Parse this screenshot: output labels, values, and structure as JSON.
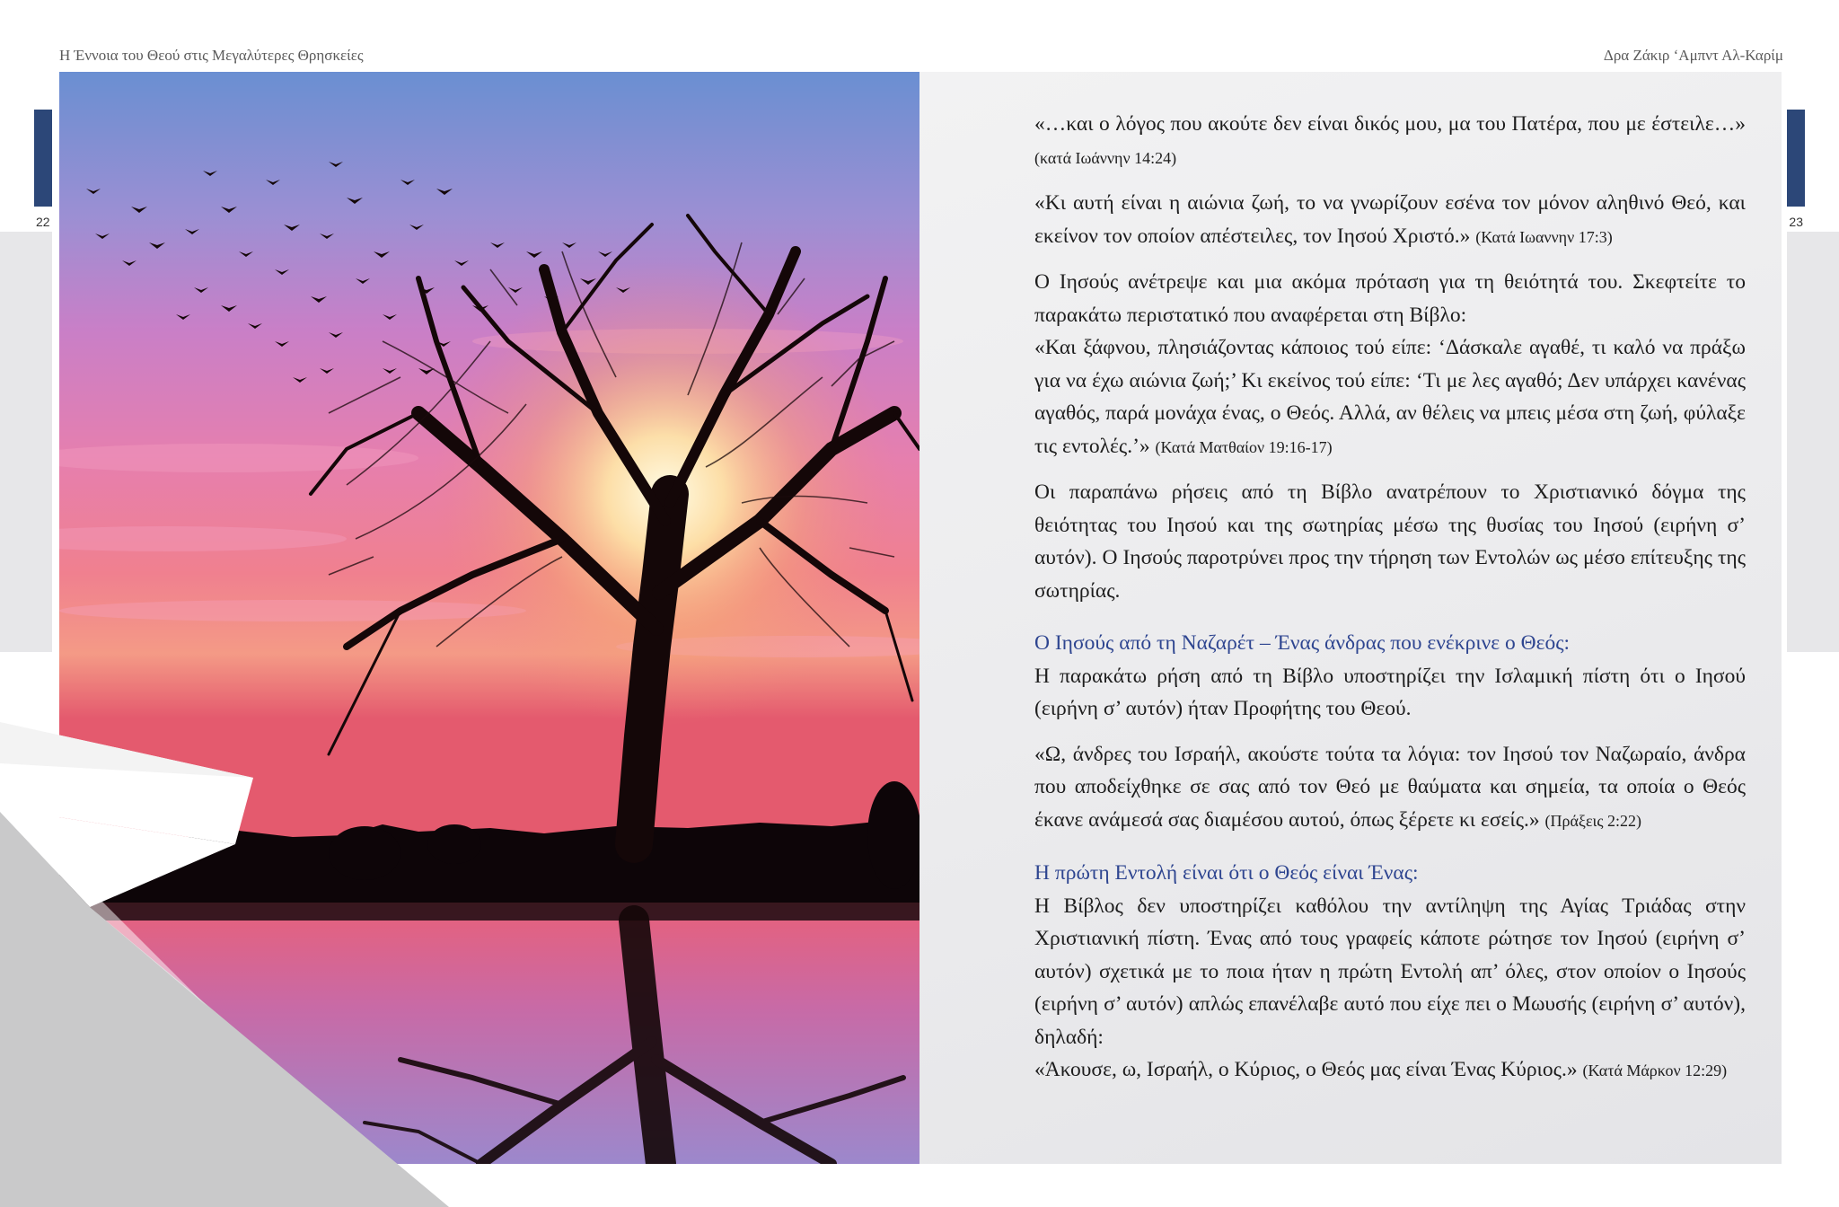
{
  "header": {
    "left_title": "Η Έννοια του Θεού στις Μεγαλύτερες Θρησκείες",
    "right_author": "Δρα Ζάκιρ ‘Αμπντ Αλ-Καρίμ"
  },
  "pages": {
    "left_number": "22",
    "right_number": "23"
  },
  "photo": {
    "icon": "tree-sunset-photo"
  },
  "text": {
    "p1_text": "«…και ο λόγος που ακούτε δεν είναι δικός μου, μα του Πατέρα, που με έστειλε…»",
    "p1_ref": "(κατά Ιωάννην 14:24)",
    "p2_text": "«Κι αυτή είναι η αιώνια ζωή, το να γνωρίζουν εσένα τον μόνον αληθινό Θεό, και εκείνον τον οποίον απέστειλες, τον Ιησού Χριστό.»",
    "p2_ref": "(Κατά Ιωαννην 17:3)",
    "p3_line1": "Ο Ιησούς ανέτρεψε και μια ακόμα πρόταση για τη θειότητά του. Σκεφτείτε το παρακάτω περιστατικό που αναφέρεται στη Βίβλο:",
    "p3_quote": "«Και ξάφνου, πλησιάζοντας κάποιος τού είπε: ‘Δάσκαλε αγαθέ, τι καλό να πράξω για να έχω αιώνια ζωή;’ Κι εκείνος τού είπε: ‘Τι με λες αγαθό; Δεν υπάρχει κανένας αγαθός, παρά μονάχα ένας, ο Θεός. Αλλά, αν θέλεις να μπεις μέσα στη ζωή, φύλαξε τις εντολές.’»",
    "p3_ref": "(Κατά Ματθαίον 19:16-17)",
    "p4_text": "Οι παραπάνω ρήσεις από τη Βίβλο ανατρέπουν το Χριστιανικό δόγμα της θειότητας του Ιησού και της σωτηρίας μέσω της θυσίας του Ιησού (ειρήνη σ’ αυτόν). Ο Ιησούς παροτρύνει προς την τήρηση των Εντολών ως μέσο επίτευξης της σωτηρίας.",
    "heading1": "Ο Ιησούς από τη Ναζαρέτ – Ένας άνδρας που ενέκρινε ο Θεός:",
    "p5_text": "Η παρακάτω ρήση από τη Βίβλο υποστηρίζει την Ισλαμική πίστη ότι ο Ιησού (ειρήνη σ’ αυτόν) ήταν Προφήτης του Θεού.",
    "p6_text": "«Ω, άνδρες του Ισραήλ, ακούστε τούτα τα λόγια: τον Ιησού τον Ναζωραίο, άνδρα που αποδείχθηκε σε σας από τον Θεό με θαύματα και σημεία, τα οποία ο Θεός έκανε ανάμεσά σας διαμέσου αυτού, όπως ξέρετε κι εσείς.»",
    "p6_ref": "(Πράξεις 2:22)",
    "heading2": "Η πρώτη Εντολή είναι ότι ο Θεός είναι Ένας:",
    "p7_text": "Η Βίβλος δεν υποστηρίζει καθόλου την αντίληψη της Αγίας Τριάδας στην Χριστιανική πίστη. Ένας από τους γραφείς κάποτε ρώτησε τον Ιησού (ειρήνη σ’ αυτόν) σχετικά με το ποια ήταν η πρώτη Εντολή απ’ όλες, στον οποίον ο Ιησούς (ειρήνη σ’ αυτόν) απλώς επανέλαβε αυτό που είχε πει ο Μωυσής (ειρήνη σ’ αυτόν), δηλαδή:",
    "p7_quote": "«Άκουσε, ω, Ισραήλ, ο Κύριος, ο Θεός μας είναι Ένας Κύριος.»",
    "p7_ref": "(Κατά Μάρκον 12:29)"
  }
}
